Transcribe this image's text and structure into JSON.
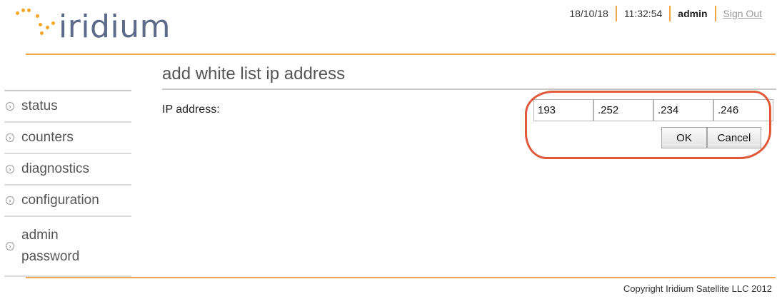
{
  "brand": {
    "logo_text": "iridium",
    "accent_color": "#f5a54a",
    "logo_color": "#5d6a8a"
  },
  "topbar": {
    "date": "18/10/18",
    "time": "11:32:54",
    "user": "admin",
    "sign_out": "Sign Out"
  },
  "sidebar": {
    "items": [
      {
        "label": "status",
        "icon": "circle-arrow-icon"
      },
      {
        "label": "counters",
        "icon": "circle-arrow-icon"
      },
      {
        "label": "diagnostics",
        "icon": "circle-arrow-icon"
      },
      {
        "label": "configuration",
        "icon": "circle-arrow-icon"
      },
      {
        "label": "admin password",
        "label_line1": "admin",
        "label_line2": "password",
        "icon": "circle-arrow-icon"
      }
    ]
  },
  "main": {
    "title": "add white list ip address",
    "ip_label": "IP address:",
    "ip_octets": [
      "193",
      ".252",
      ".234",
      ".246"
    ],
    "ok_label": "OK",
    "cancel_label": "Cancel",
    "highlight_color": "#e05a3a"
  },
  "footer": {
    "copyright": "Copyright Iridium Satellite LLC 2012"
  }
}
